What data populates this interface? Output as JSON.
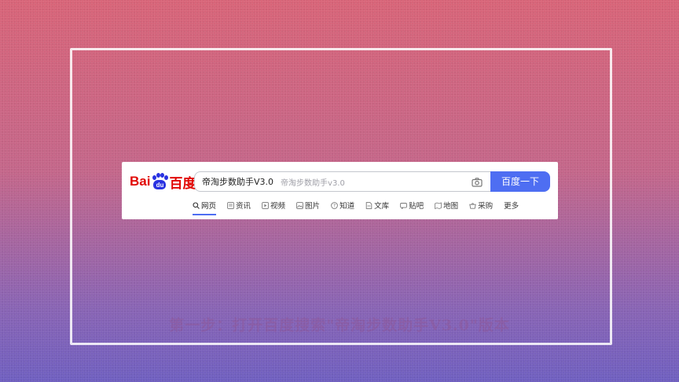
{
  "logo": {
    "left_text": "Bai",
    "paw_text": "du",
    "right_text": "百度"
  },
  "search": {
    "value": "帝淘步数助手V3.0",
    "placeholder": "帝淘步数助手v3.0",
    "button_label": "百度一下",
    "camera_icon": "camera-icon"
  },
  "tabs": [
    {
      "label": "网页",
      "icon": "search-icon",
      "active": true
    },
    {
      "label": "资讯",
      "icon": "news-icon"
    },
    {
      "label": "视频",
      "icon": "video-icon"
    },
    {
      "label": "图片",
      "icon": "image-icon"
    },
    {
      "label": "知道",
      "icon": "question-icon"
    },
    {
      "label": "文库",
      "icon": "document-icon"
    },
    {
      "label": "贴吧",
      "icon": "tieba-icon"
    },
    {
      "label": "地图",
      "icon": "map-icon"
    },
    {
      "label": "采购",
      "icon": "basket-icon"
    },
    {
      "label": "更多"
    }
  ],
  "caption": "第一步：打开百度搜索\"帝淘步数助手V3.0\"版本",
  "colors": {
    "accent": "#4e6ef2",
    "logo_red": "#e10602",
    "logo_blue": "#2932e1"
  }
}
